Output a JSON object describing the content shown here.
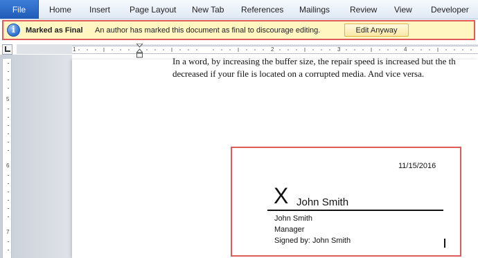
{
  "ribbon": {
    "tabs": [
      {
        "label": "File"
      },
      {
        "label": "Home"
      },
      {
        "label": "Insert"
      },
      {
        "label": "Page Layout"
      },
      {
        "label": "New Tab"
      },
      {
        "label": "References"
      },
      {
        "label": "Mailings"
      },
      {
        "label": "Review"
      },
      {
        "label": "View"
      },
      {
        "label": "Developer"
      }
    ]
  },
  "message_bar": {
    "icon": "info-icon",
    "title": "Marked as Final",
    "text": "An author has marked this document as final to discourage editing.",
    "button_label": "Edit Anyway",
    "background_color": "#fff6c2",
    "highlight_color": "#e05a5a"
  },
  "ruler": {
    "horizontal_numbers": [
      "1",
      "2",
      "3",
      "4"
    ],
    "vertical_numbers": [
      "5",
      "6",
      "7"
    ]
  },
  "document": {
    "paragraph_lines": [
      "In a word, by increasing the buffer size, the repair speed is increased but the th",
      "decreased if your file is located on a corrupted media. And vice versa."
    ]
  },
  "signature": {
    "date": "11/15/2016",
    "x_mark": "X",
    "signer_name": "John Smith",
    "signer_line": "John Smith",
    "title": "Manager",
    "signed_by": "Signed by: John Smith"
  }
}
